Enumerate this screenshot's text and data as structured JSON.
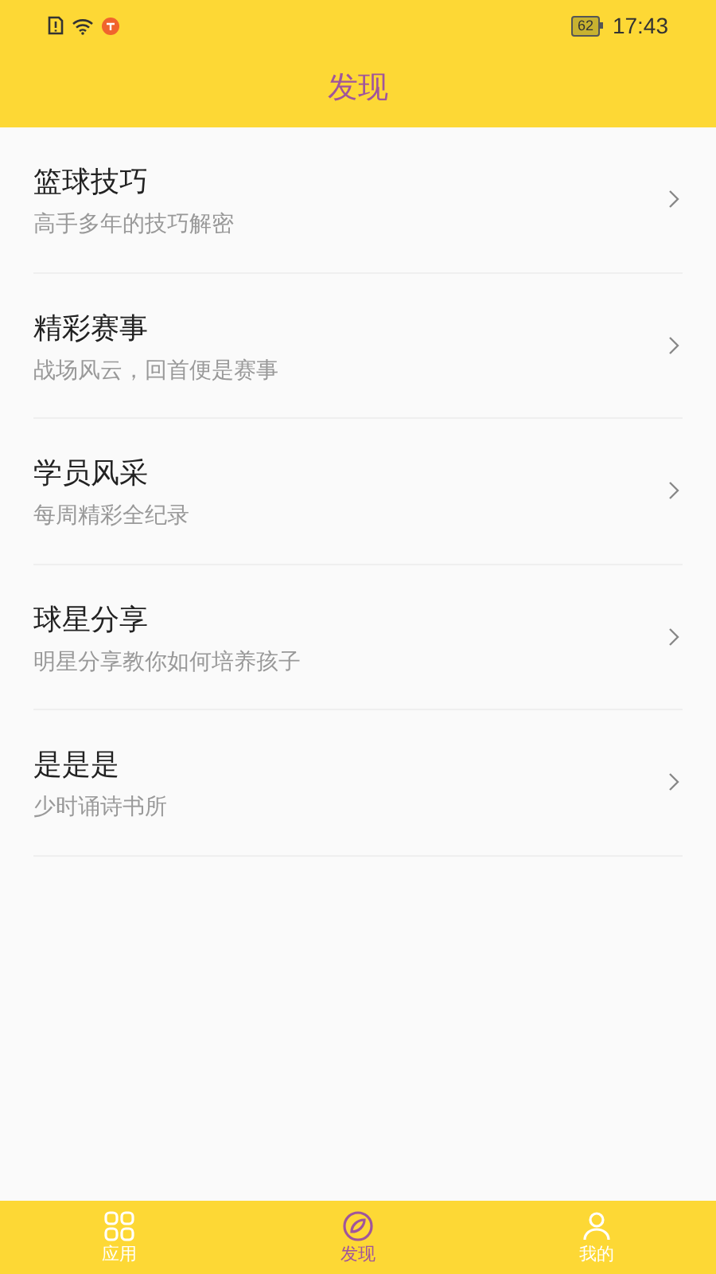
{
  "status_bar": {
    "time": "17:43",
    "battery": "62"
  },
  "header": {
    "title": "发现"
  },
  "items": [
    {
      "title": "篮球技巧",
      "subtitle": "高手多年的技巧解密"
    },
    {
      "title": "精彩赛事",
      "subtitle": "战场风云，回首便是赛事"
    },
    {
      "title": "学员风采",
      "subtitle": "每周精彩全纪录"
    },
    {
      "title": "球星分享",
      "subtitle": "明星分享教你如何培养孩子"
    },
    {
      "title": "是是是",
      "subtitle": "少时诵诗书所"
    }
  ],
  "bottom_nav": [
    {
      "kind": "apps",
      "label": "应用",
      "selected": false
    },
    {
      "kind": "discover",
      "label": "发现",
      "selected": true
    },
    {
      "kind": "profile",
      "label": "我的",
      "selected": false
    }
  ]
}
